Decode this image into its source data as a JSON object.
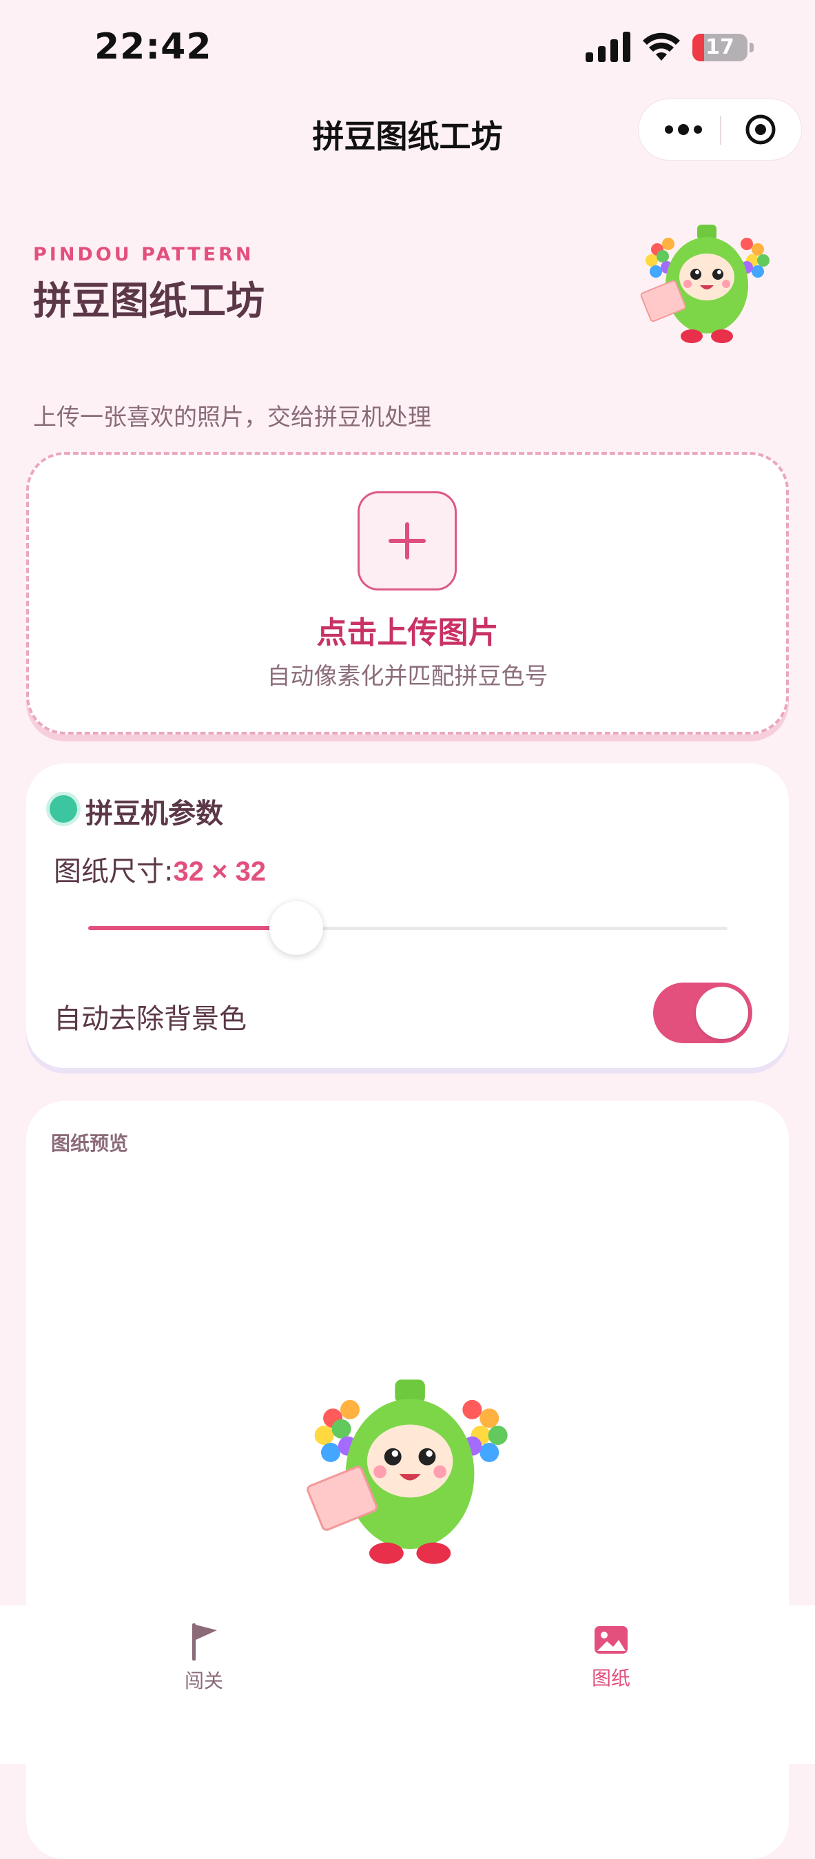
{
  "status_bar": {
    "time": "22:42",
    "battery": "17"
  },
  "nav": {
    "title": "拼豆图纸工坊"
  },
  "header": {
    "kicker": "PINDOU PATTERN",
    "title": "拼豆图纸工坊",
    "subtitle": "上传一张喜欢的照片，交给拼豆机处理"
  },
  "upload": {
    "title": "点击上传图片",
    "description": "自动像素化并匹配拼豆色号"
  },
  "params": {
    "title": "拼豆机参数",
    "size_label": "图纸尺寸:",
    "size_value": "32 × 32",
    "size_slider": 0.325,
    "remove_bg_label": "自动去除背景色",
    "remove_bg_enabled": true
  },
  "preview": {
    "title": "图纸预览"
  },
  "tabbar": {
    "items": [
      {
        "label": "闯关",
        "icon": "flag-icon",
        "active": false
      },
      {
        "label": "图纸",
        "icon": "image-icon",
        "active": true
      }
    ]
  },
  "colors": {
    "accent": "#e3507e",
    "background": "#fef1f5",
    "toggle_on": "#e3507e",
    "status_dot": "#3cc6a0"
  }
}
